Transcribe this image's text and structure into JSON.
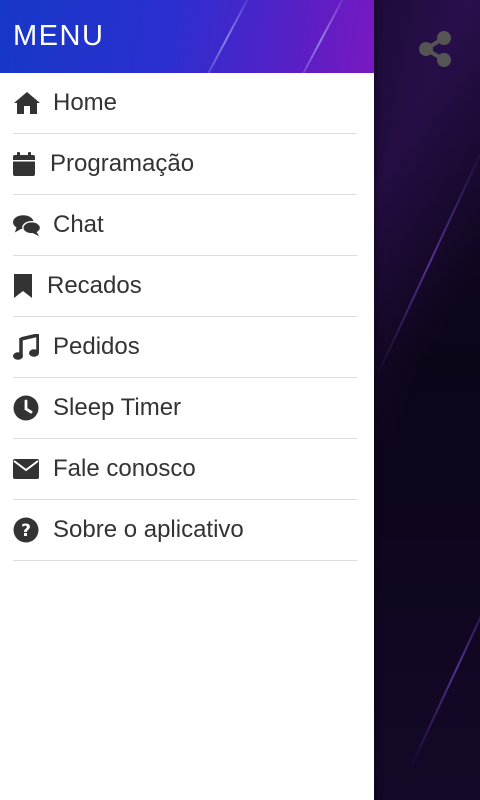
{
  "drawer": {
    "title": "MENU",
    "items": [
      {
        "label": "Home",
        "icon": "home-icon"
      },
      {
        "label": "Programação",
        "icon": "calendar-icon"
      },
      {
        "label": "Chat",
        "icon": "chat-icon"
      },
      {
        "label": "Recados",
        "icon": "bookmark-icon"
      },
      {
        "label": "Pedidos",
        "icon": "music-note-icon"
      },
      {
        "label": "Sleep Timer",
        "icon": "clock-icon"
      },
      {
        "label": "Fale conosco",
        "icon": "envelope-icon"
      },
      {
        "label": "Sobre o aplicativo",
        "icon": "question-circle-icon"
      }
    ]
  },
  "toolbar": {
    "share_icon": "share-icon"
  },
  "colors": {
    "header_start": "#1638c8",
    "header_end": "#7a18c0",
    "text": "#333333",
    "divider": "#dddddd"
  }
}
